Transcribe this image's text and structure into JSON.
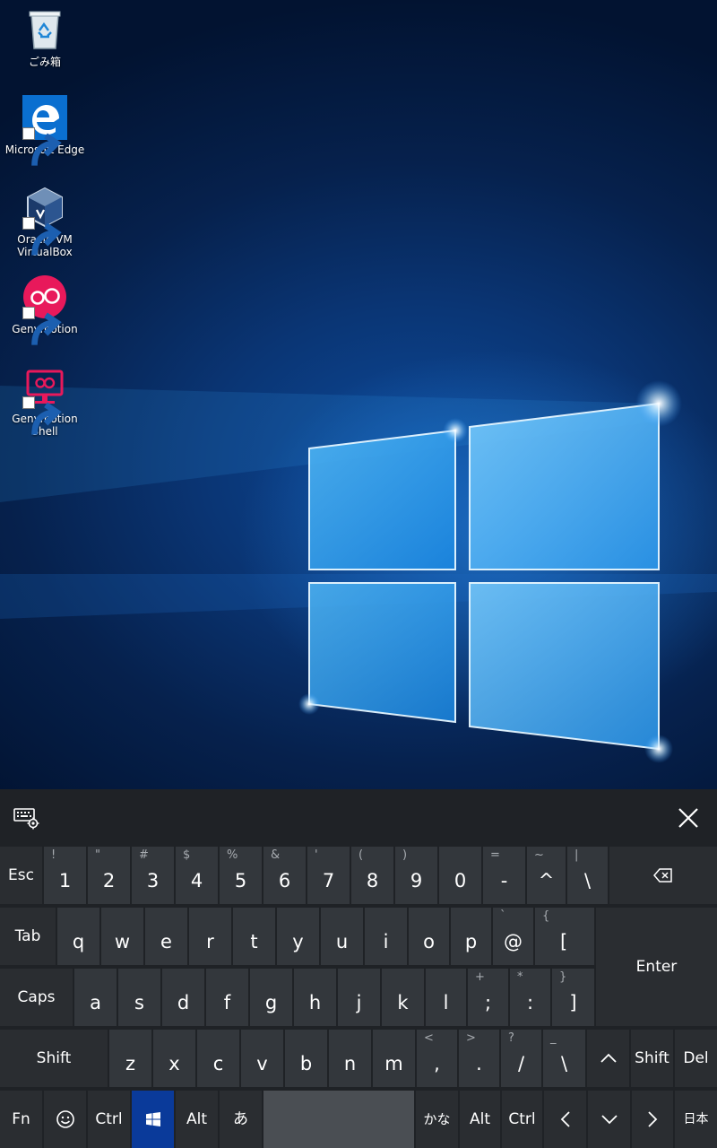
{
  "desktop": {
    "icons": [
      {
        "id": "recycle-bin",
        "label": "ごみ箱",
        "icon": "recycle-bin-icon"
      },
      {
        "id": "microsoft-edge",
        "label": "Microsoft Edge",
        "icon": "edge-icon"
      },
      {
        "id": "virtualbox",
        "label": "Oracle VM VirtualBox",
        "icon": "virtualbox-icon"
      },
      {
        "id": "genymotion",
        "label": "Genymotion",
        "icon": "genymotion-icon"
      },
      {
        "id": "genymotion-shell",
        "label": "Genymotion Shell",
        "icon": "genymotion-shell-icon"
      }
    ],
    "wallpaper": "windows-10-hero",
    "colors": {
      "edge_blue": "#0a6fd0",
      "genymotion_pink": "#e8195b",
      "accent": "#0a3a9a"
    }
  },
  "keyboard": {
    "settings_icon": "keyboard-settings-icon",
    "close_icon": "close-icon",
    "rows": {
      "r1": [
        {
          "id": "esc",
          "main": "Esc"
        },
        {
          "id": "1",
          "main": "1",
          "sub": "!"
        },
        {
          "id": "2",
          "main": "2",
          "sub": "\""
        },
        {
          "id": "3",
          "main": "3",
          "sub": "#"
        },
        {
          "id": "4",
          "main": "4",
          "sub": "$"
        },
        {
          "id": "5",
          "main": "5",
          "sub": "%"
        },
        {
          "id": "6",
          "main": "6",
          "sub": "&"
        },
        {
          "id": "7",
          "main": "7",
          "sub": "'"
        },
        {
          "id": "8",
          "main": "8",
          "sub": "("
        },
        {
          "id": "9",
          "main": "9",
          "sub": ")"
        },
        {
          "id": "0",
          "main": "0"
        },
        {
          "id": "minus",
          "main": "-",
          "sub": "="
        },
        {
          "id": "caret",
          "main": "^",
          "sub": "~"
        },
        {
          "id": "yen",
          "main": "\\",
          "sub": "|"
        },
        {
          "id": "backspace",
          "icon": "backspace-icon"
        }
      ],
      "r2": [
        {
          "id": "tab",
          "main": "Tab"
        },
        {
          "id": "q",
          "main": "q"
        },
        {
          "id": "w",
          "main": "w"
        },
        {
          "id": "e",
          "main": "e"
        },
        {
          "id": "r",
          "main": "r"
        },
        {
          "id": "t",
          "main": "t"
        },
        {
          "id": "y",
          "main": "y"
        },
        {
          "id": "u",
          "main": "u"
        },
        {
          "id": "i",
          "main": "i"
        },
        {
          "id": "o",
          "main": "o"
        },
        {
          "id": "p",
          "main": "p"
        },
        {
          "id": "at",
          "main": "@",
          "sub": "`"
        },
        {
          "id": "lbracket",
          "main": "[",
          "sub": "{"
        },
        {
          "id": "enter",
          "main": "Enter"
        }
      ],
      "r3": [
        {
          "id": "caps",
          "main": "Caps"
        },
        {
          "id": "a",
          "main": "a"
        },
        {
          "id": "s",
          "main": "s"
        },
        {
          "id": "d",
          "main": "d"
        },
        {
          "id": "f",
          "main": "f"
        },
        {
          "id": "g",
          "main": "g"
        },
        {
          "id": "h",
          "main": "h"
        },
        {
          "id": "j",
          "main": "j"
        },
        {
          "id": "k",
          "main": "k"
        },
        {
          "id": "l",
          "main": "l"
        },
        {
          "id": "semicolon",
          "main": ";",
          "sub": "+"
        },
        {
          "id": "colon",
          "main": ":",
          "sub": "*"
        },
        {
          "id": "rbracket",
          "main": "]",
          "sub": "}"
        }
      ],
      "r4": [
        {
          "id": "shift-left",
          "main": "Shift"
        },
        {
          "id": "z",
          "main": "z"
        },
        {
          "id": "x",
          "main": "x"
        },
        {
          "id": "c",
          "main": "c"
        },
        {
          "id": "v",
          "main": "v"
        },
        {
          "id": "b",
          "main": "b"
        },
        {
          "id": "n",
          "main": "n"
        },
        {
          "id": "m",
          "main": "m"
        },
        {
          "id": "comma",
          "main": ",",
          "sub": "<"
        },
        {
          "id": "period",
          "main": ".",
          "sub": ">"
        },
        {
          "id": "slash",
          "main": "/",
          "sub": "?"
        },
        {
          "id": "backslash",
          "main": "\\",
          "sub": "_"
        },
        {
          "id": "up",
          "icon": "arrow-up-icon"
        },
        {
          "id": "shift-right",
          "main": "Shift"
        },
        {
          "id": "del",
          "main": "Del"
        }
      ],
      "r5": [
        {
          "id": "fn",
          "main": "Fn"
        },
        {
          "id": "emoji",
          "icon": "emoji-icon"
        },
        {
          "id": "ctrl-left",
          "main": "Ctrl"
        },
        {
          "id": "windows",
          "icon": "windows-logo-icon"
        },
        {
          "id": "alt-left",
          "main": "Alt"
        },
        {
          "id": "hiragana",
          "main": "あ"
        },
        {
          "id": "space",
          "main": ""
        },
        {
          "id": "kana",
          "main": "かな"
        },
        {
          "id": "alt-right",
          "main": "Alt"
        },
        {
          "id": "ctrl-right",
          "main": "Ctrl"
        },
        {
          "id": "left",
          "icon": "arrow-left-icon"
        },
        {
          "id": "down",
          "icon": "arrow-down-icon"
        },
        {
          "id": "right",
          "icon": "arrow-right-icon"
        },
        {
          "id": "language",
          "main": "日本"
        }
      ]
    }
  }
}
